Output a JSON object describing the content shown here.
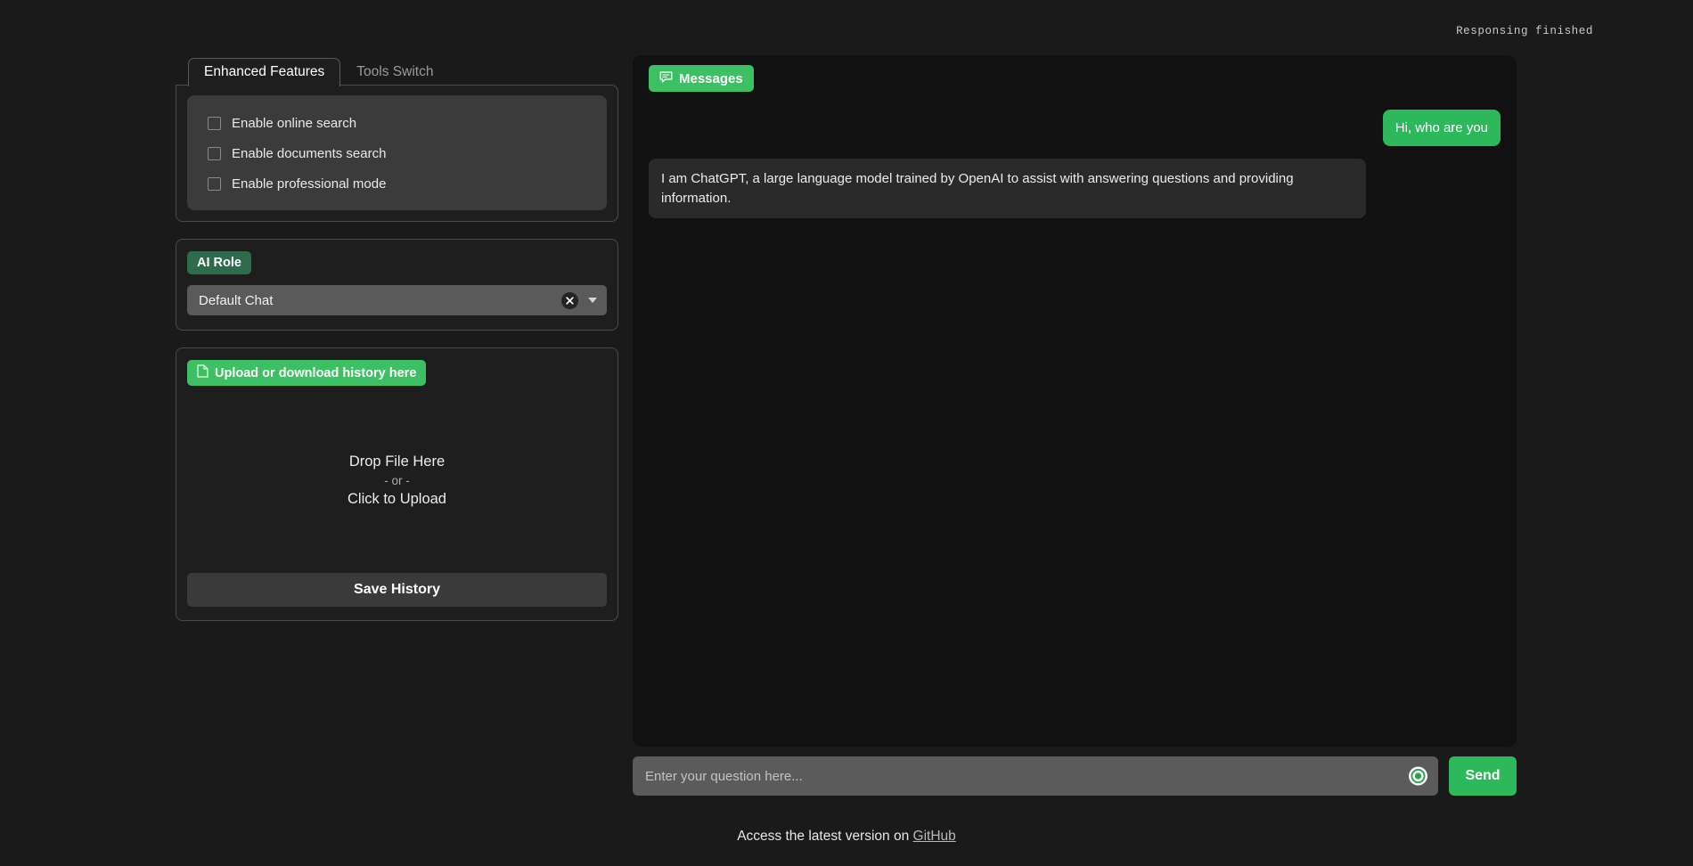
{
  "status": {
    "text": "Responsing finished"
  },
  "sidebar": {
    "tabs": [
      {
        "label": "Enhanced Features",
        "active": true
      },
      {
        "label": "Tools Switch",
        "active": false
      }
    ],
    "features": [
      {
        "label": "Enable online search",
        "checked": false
      },
      {
        "label": "Enable documents search",
        "checked": false
      },
      {
        "label": "Enable professional mode",
        "checked": false
      }
    ],
    "role": {
      "badge_label": "AI Role",
      "selected": "Default Chat",
      "clear_icon": "close-x-icon",
      "caret_icon": "chevron-down-icon"
    },
    "upload": {
      "badge_label": "Upload or download history here",
      "badge_icon": "file-icon",
      "drop_line1": "Drop File Here",
      "drop_line2": "- or -",
      "drop_line3": "Click to Upload",
      "save_label": "Save History"
    }
  },
  "chat": {
    "badge_label": "Messages",
    "badge_icon": "chat-bubble-icon",
    "messages": [
      {
        "role": "user",
        "text": "Hi, who are you"
      },
      {
        "role": "assistant",
        "text": "I am ChatGPT, a large language model trained by OpenAI to assist with answering questions and providing information."
      }
    ],
    "input_placeholder": "Enter your question here...",
    "input_value": "",
    "mic_icon": "microphone-record-icon",
    "send_label": "Send"
  },
  "footer": {
    "text": "Access the latest version on",
    "link_label": "GitHub"
  },
  "colors": {
    "accent_green": "#2eb85c",
    "badge_green": "#3dbf63",
    "role_green": "#2e6b4b",
    "page_bg": "#1a1a1a",
    "chat_bg": "#111111",
    "panel_bg": "#1e1e1e"
  }
}
